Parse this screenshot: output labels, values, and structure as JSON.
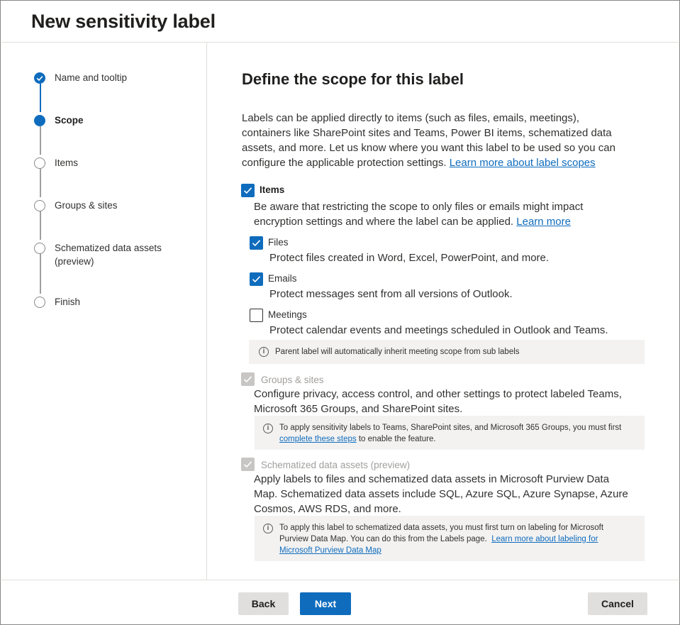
{
  "window": {
    "title": "New sensitivity label"
  },
  "stepper": {
    "steps": [
      {
        "label": "Name and tooltip",
        "state": "done"
      },
      {
        "label": "Scope",
        "state": "current"
      },
      {
        "label": "Items",
        "state": "todo"
      },
      {
        "label": "Groups & sites",
        "state": "todo"
      },
      {
        "label": "Schematized data assets",
        "label_line2": "(preview)",
        "state": "todo"
      },
      {
        "label": "Finish",
        "state": "todo"
      }
    ]
  },
  "main": {
    "heading": "Define the scope for this label",
    "intro_lines": [
      "Labels can be applied directly to items (such as files, emails, meetings),",
      "containers like SharePoint sites and Teams, Power BI items, schematized data",
      "assets, and more. Let us know where you want this label to be used so you can",
      "configure the applicable protection settings."
    ],
    "intro_link": "Learn more about label scopes",
    "items": {
      "label": "Items",
      "checked": true,
      "desc_line1": "Be aware that restricting the scope to only files or emails might impact",
      "desc_line2": "encryption settings and where the label can be applied.",
      "desc_link": "Learn more",
      "files": {
        "label": "Files",
        "checked": true,
        "desc": "Protect files created in Word, Excel, PowerPoint, and more."
      },
      "emails": {
        "label": "Emails",
        "checked": true,
        "desc": "Protect messages sent from all versions of Outlook."
      },
      "meetings": {
        "label": "Meetings",
        "checked": false,
        "desc": "Protect calendar events and meetings scheduled in Outlook and Teams."
      },
      "info": "Parent label will automatically inherit meeting scope from sub labels"
    },
    "groups": {
      "label": "Groups & sites",
      "checked": true,
      "disabled": true,
      "desc_line1": "Configure privacy, access control, and other settings to protect labeled Teams,",
      "desc_line2": "Microsoft 365 Groups, and SharePoint sites.",
      "info_line1": "To apply sensitivity labels to Teams, SharePoint sites, and Microsoft 365 Groups, you must first",
      "info_link": "complete these steps",
      "info_line2_rest": " to enable the feature."
    },
    "schematized": {
      "label": "Schematized data assets (preview)",
      "checked": true,
      "disabled": true,
      "desc_line1": "Apply labels to files and schematized data assets in Microsoft Purview Data",
      "desc_line2": "Map. Schematized data assets include SQL, Azure SQL, Azure Synapse, Azure",
      "desc_line3": "Cosmos, AWS RDS, and more.",
      "info_line1": "To apply this label to schematized data assets, you must first turn on labeling for Microsoft",
      "info_line2": "Purview Data Map. You can do this from the Labels page.",
      "info_link_part1": "Learn more about labeling for",
      "info_link_part2": "Microsoft Purview Data Map"
    }
  },
  "footer": {
    "back_label": "Back",
    "next_label": "Next",
    "cancel_label": "Cancel"
  },
  "colors": {
    "accent": "#0f6cbd",
    "info_bg": "#f3f2f1",
    "disabled": "#c8c6c4"
  }
}
